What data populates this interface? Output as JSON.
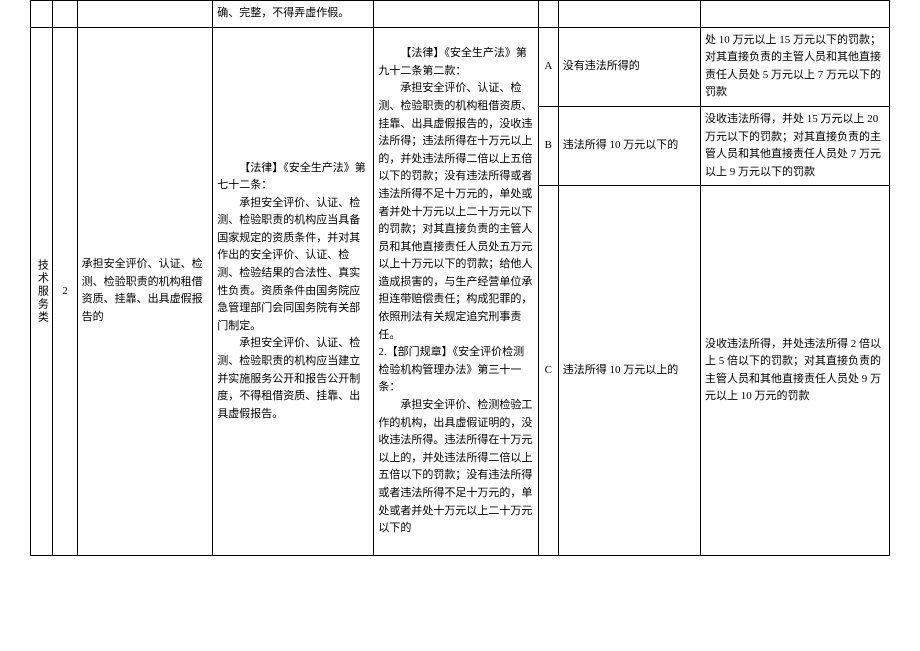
{
  "header": {
    "frag": "确、完整，不得弄虚作假。"
  },
  "row": {
    "category": "技术服务类",
    "num": "2",
    "item": "承担安全评价、认证、检测、检验职责的机构租借资质、挂靠、出具虚假报告的",
    "basis_p1_label": "【法律】《安全生产法》第七十二条：",
    "basis_p1_body": "承担安全评价、认证、检测、检验职责的机构应当具备国家规定的资质条件，并对其作出的安全评价、认证、检测、检验结果的合法性、真实性负责。资质条件由国务院应急管理部门会同国务院有关部门制定。",
    "basis_p2_body": "承担安全评价、认证、检测、检验职责的机构应当建立并实施服务公开和报告公开制度，不得租借资质、挂靠、出具虚假报告。",
    "detail_p1_label": "【法律】《安全生产法》第九十二条第二款：",
    "detail_p1_body": "承担安全评价、认证、检测、检验职责的机构租借资质、挂靠、出具虚假报告的，没收违法所得；违法所得在十万元以上的，并处违法所得二倍以上五倍以下的罚款；没有违法所得或者违法所得不足十万元的，单处或者并处十万元以上二十万元以下的罚款；对其直接负责的主管人员和其他直接责任人员处五万元以上十万元以下的罚款；给他人造成损害的，与生产经营单位承担连带赔偿责任；构成犯罪的，依照刑法有关规定追究刑事责任。",
    "detail_p2_label": "2.【部门规章】《安全评价检测检验机构管理办法》第三十一条：",
    "detail_p2_body": "承担安全评价、检测检验工作的机构，出具虚假证明的，没收违法所得。违法所得在十万元以上的，并处违法所得二倍以上五倍以下的罚款；没有违法所得或者违法所得不足十万元的，单处或者并处十万元以上二十万元以下的",
    "subs": [
      {
        "code": "A",
        "cond": "没有违法所得的",
        "penalty": "处 10 万元以上 15 万元以下的罚款；对其直接负责的主管人员和其他直接责任人员处 5 万元以上 7 万元以下的罚款"
      },
      {
        "code": "B",
        "cond": "违法所得 10 万元以下的",
        "penalty": "没收违法所得，并处 15 万元以上 20 万元以下的罚款；对其直接负责的主管人员和其他直接责任人员处 7 万元以上 9 万元以下的罚款"
      },
      {
        "code": "C",
        "cond": "违法所得 10 万元以上的",
        "penalty": "没收违法所得，并处违法所得 2 倍以上 5 倍以下的罚款；对其直接负责的主管人员和其他直接责任人员处 9 万元以上 10 万元的罚款"
      }
    ]
  }
}
